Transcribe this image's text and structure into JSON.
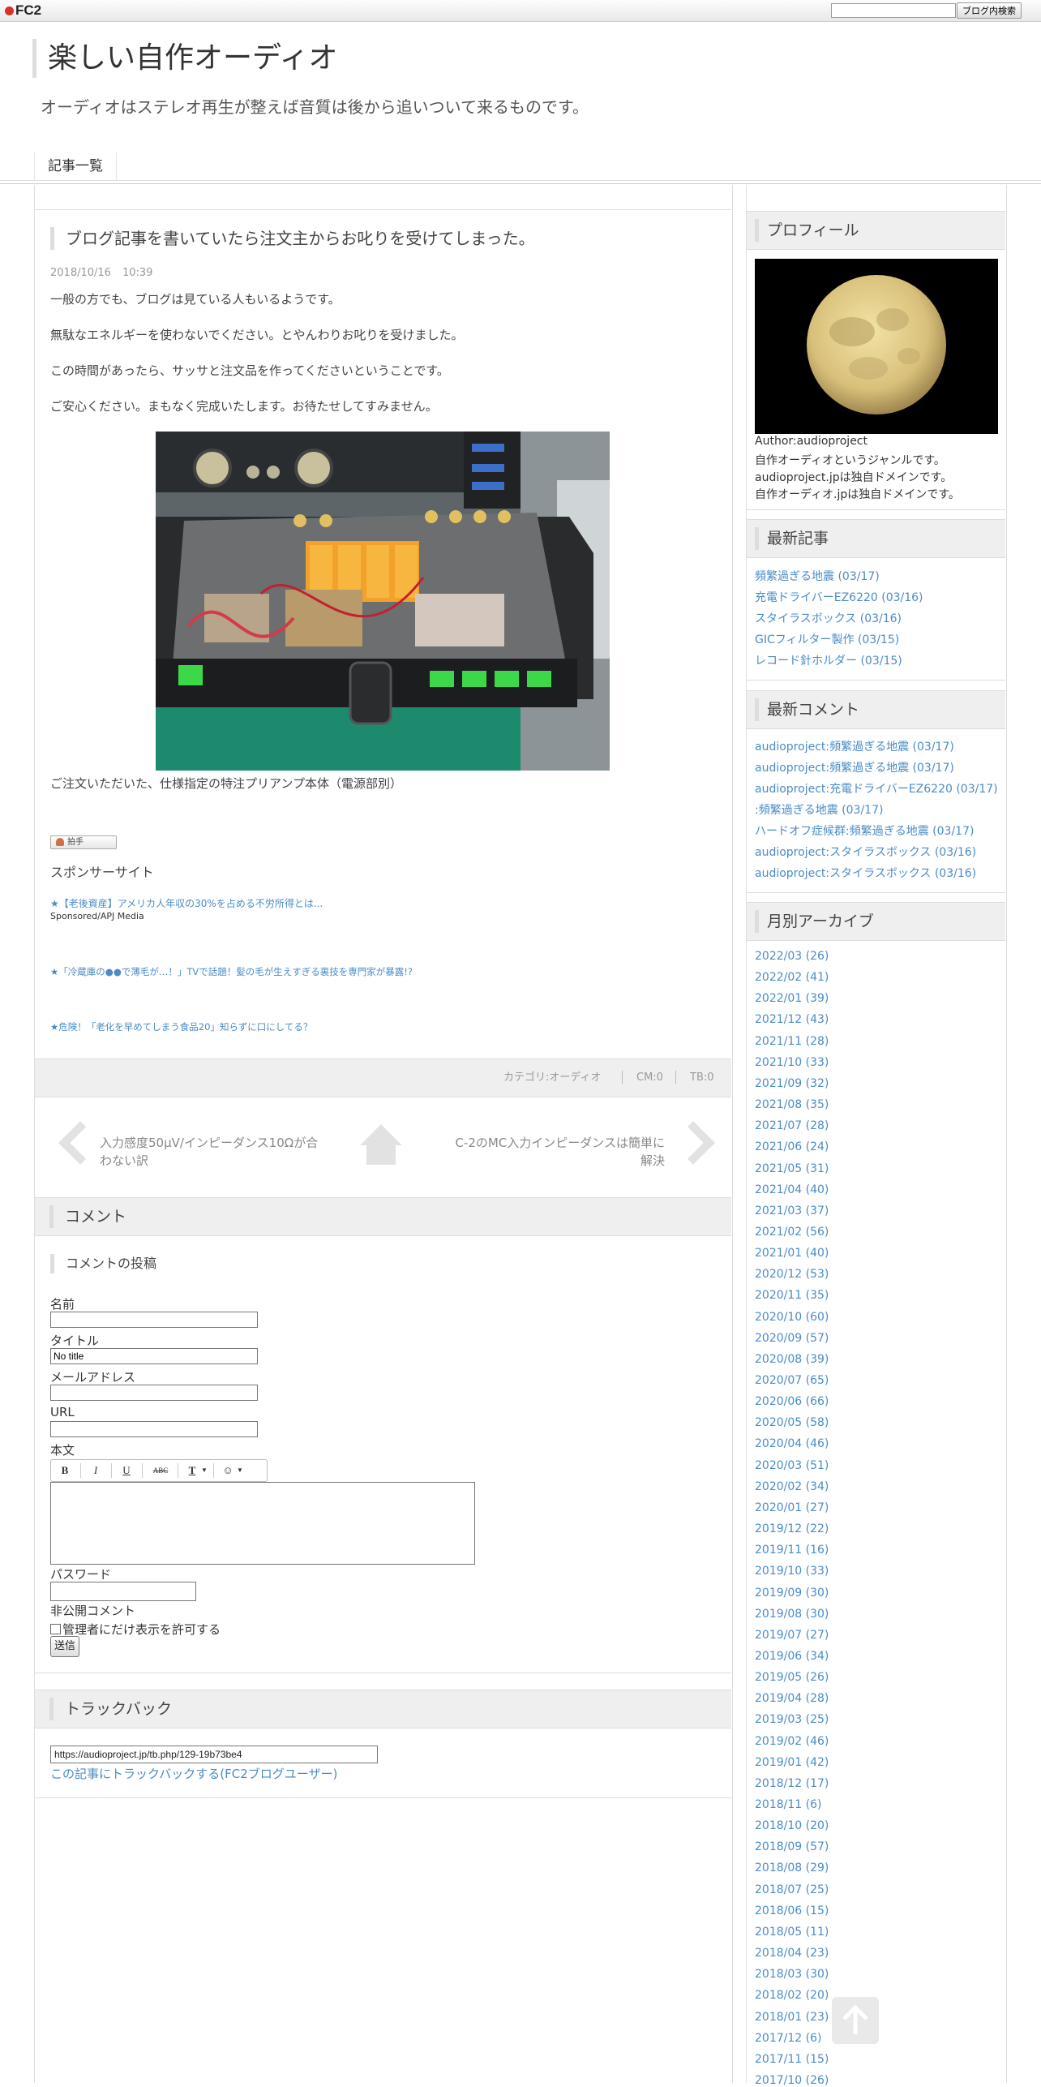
{
  "topbar": {
    "logo": "FC2",
    "search_button": "ブログ内検索",
    "search_value": ""
  },
  "blog": {
    "title": "楽しい自作オーディオ",
    "description": "オーディオはステレオ再生が整えば音質は後から追いついて来るものです。"
  },
  "nav": {
    "item": "記事一覧"
  },
  "post": {
    "title": "ブログ記事を書いていたら注文主からお叱りを受けてしまった。",
    "date": "2018/10/16",
    "time": "10:39",
    "paragraphs": [
      "一般の方でも、ブログは見ている人もいるようです。",
      "無駄なエネルギーを使わないでください。とやんわりお叱りを受けました。",
      "この時間があったら、サッサと注文品を作ってくださいということです。",
      "ご安心ください。まもなく完成いたします。お待たせしてすみません。"
    ],
    "caption": "ご注文いただいた、仕様指定の特注プリアンプ本体（電源部別）",
    "clap_label": "拍手",
    "sponsor_heading": "スポンサーサイト",
    "ads": [
      {
        "text": "★【老後資産】アメリカ人年収の30%を占める不労所得とは...",
        "sub": "Sponsored/APJ Media"
      },
      {
        "text": "★「冷蔵庫の●●で薄毛が…！」TVで話題！髪の毛が生えすぎる裏技を専門家が暴露!?"
      },
      {
        "text": "★危険！「老化を早めてしまう食品20」知らずに口にしてる？"
      }
    ],
    "meta": {
      "category": "カテゴリ:オーディオ",
      "comments": "CM:0",
      "trackbacks": "TB:0"
    }
  },
  "pager": {
    "prev": "入力感度50µV/インピーダンス10Ωが合わない訳",
    "next": "C-2のMC入力インピーダンスは簡単に解決"
  },
  "comments": {
    "heading": "コメント",
    "form_heading": "コメントの投稿",
    "labels": {
      "name": "名前",
      "title": "タイトル",
      "email": "メールアドレス",
      "url": "URL",
      "body": "本文",
      "password": "パスワード",
      "private": "非公開コメント",
      "private_check": "管理者にだけ表示を許可する"
    },
    "title_value": "No title",
    "submit": "送信",
    "toolbar": {
      "bold": "B",
      "italic": "I",
      "underline": "U",
      "strike": "ABC",
      "font": "T",
      "emoji": "☺"
    }
  },
  "trackback": {
    "heading": "トラックバック",
    "url": "https://audioproject.jp/tb.php/129-19b73be4",
    "link": "この記事にトラックバックする(FC2ブログユーザー)"
  },
  "sidebar": {
    "profile": {
      "heading": "プロフィール",
      "lines": [
        "Author:audioproject",
        "自作オーディオというジャンルです。",
        "audioproject.jpは独自ドメインです。",
        "自作オーディオ.jpは独自ドメインです。"
      ]
    },
    "recent_posts": {
      "heading": "最新記事",
      "items": [
        "頻繁過ぎる地震 (03/17)",
        "充電ドライバーEZ6220 (03/16)",
        "スタイラスボックス (03/16)",
        "GICフィルター製作 (03/15)",
        "レコード針ホルダー (03/15)"
      ]
    },
    "recent_comments": {
      "heading": "最新コメント",
      "items": [
        "audioproject:頻繁過ぎる地震 (03/17)",
        "audioproject:頻繁過ぎる地震 (03/17)",
        "audioproject:充電ドライバーEZ6220 (03/17)",
        ":頻繁過ぎる地震 (03/17)",
        "ハードオフ症候群:頻繁過ぎる地震 (03/17)",
        "audioproject:スタイラスボックス (03/16)",
        "audioproject:スタイラスボックス (03/16)"
      ]
    },
    "archives": {
      "heading": "月別アーカイブ",
      "items": [
        "2022/03 (26)",
        "2022/02 (41)",
        "2022/01 (39)",
        "2021/12 (43)",
        "2021/11 (28)",
        "2021/10 (33)",
        "2021/09 (32)",
        "2021/08 (35)",
        "2021/07 (28)",
        "2021/06 (24)",
        "2021/05 (31)",
        "2021/04 (40)",
        "2021/03 (37)",
        "2021/02 (56)",
        "2021/01 (40)",
        "2020/12 (53)",
        "2020/11 (35)",
        "2020/10 (60)",
        "2020/09 (57)",
        "2020/08 (39)",
        "2020/07 (65)",
        "2020/06 (66)",
        "2020/05 (58)",
        "2020/04 (46)",
        "2020/03 (51)",
        "2020/02 (34)",
        "2020/01 (27)",
        "2019/12 (22)",
        "2019/11 (16)",
        "2019/10 (33)",
        "2019/09 (30)",
        "2019/08 (30)",
        "2019/07 (27)",
        "2019/06 (34)",
        "2019/05 (26)",
        "2019/04 (28)",
        "2019/03 (25)",
        "2019/02 (46)",
        "2019/01 (42)",
        "2018/12 (17)",
        "2018/11 (6)",
        "2018/10 (20)",
        "2018/09 (57)",
        "2018/08 (29)",
        "2018/07 (25)",
        "2018/06 (15)",
        "2018/05 (11)",
        "2018/04 (23)",
        "2018/03 (30)",
        "2018/02 (20)",
        "2018/01 (23)",
        "2017/12 (6)",
        "2017/11 (15)",
        "2017/10 (26)"
      ]
    }
  },
  "icons": {
    "back_to_top": "arrow-up-icon",
    "prev": "chevron-left-icon",
    "next": "chevron-right-icon",
    "home": "home-icon"
  },
  "colors": {
    "link": "#4a8cc7",
    "heading_bg": "#efefef"
  }
}
